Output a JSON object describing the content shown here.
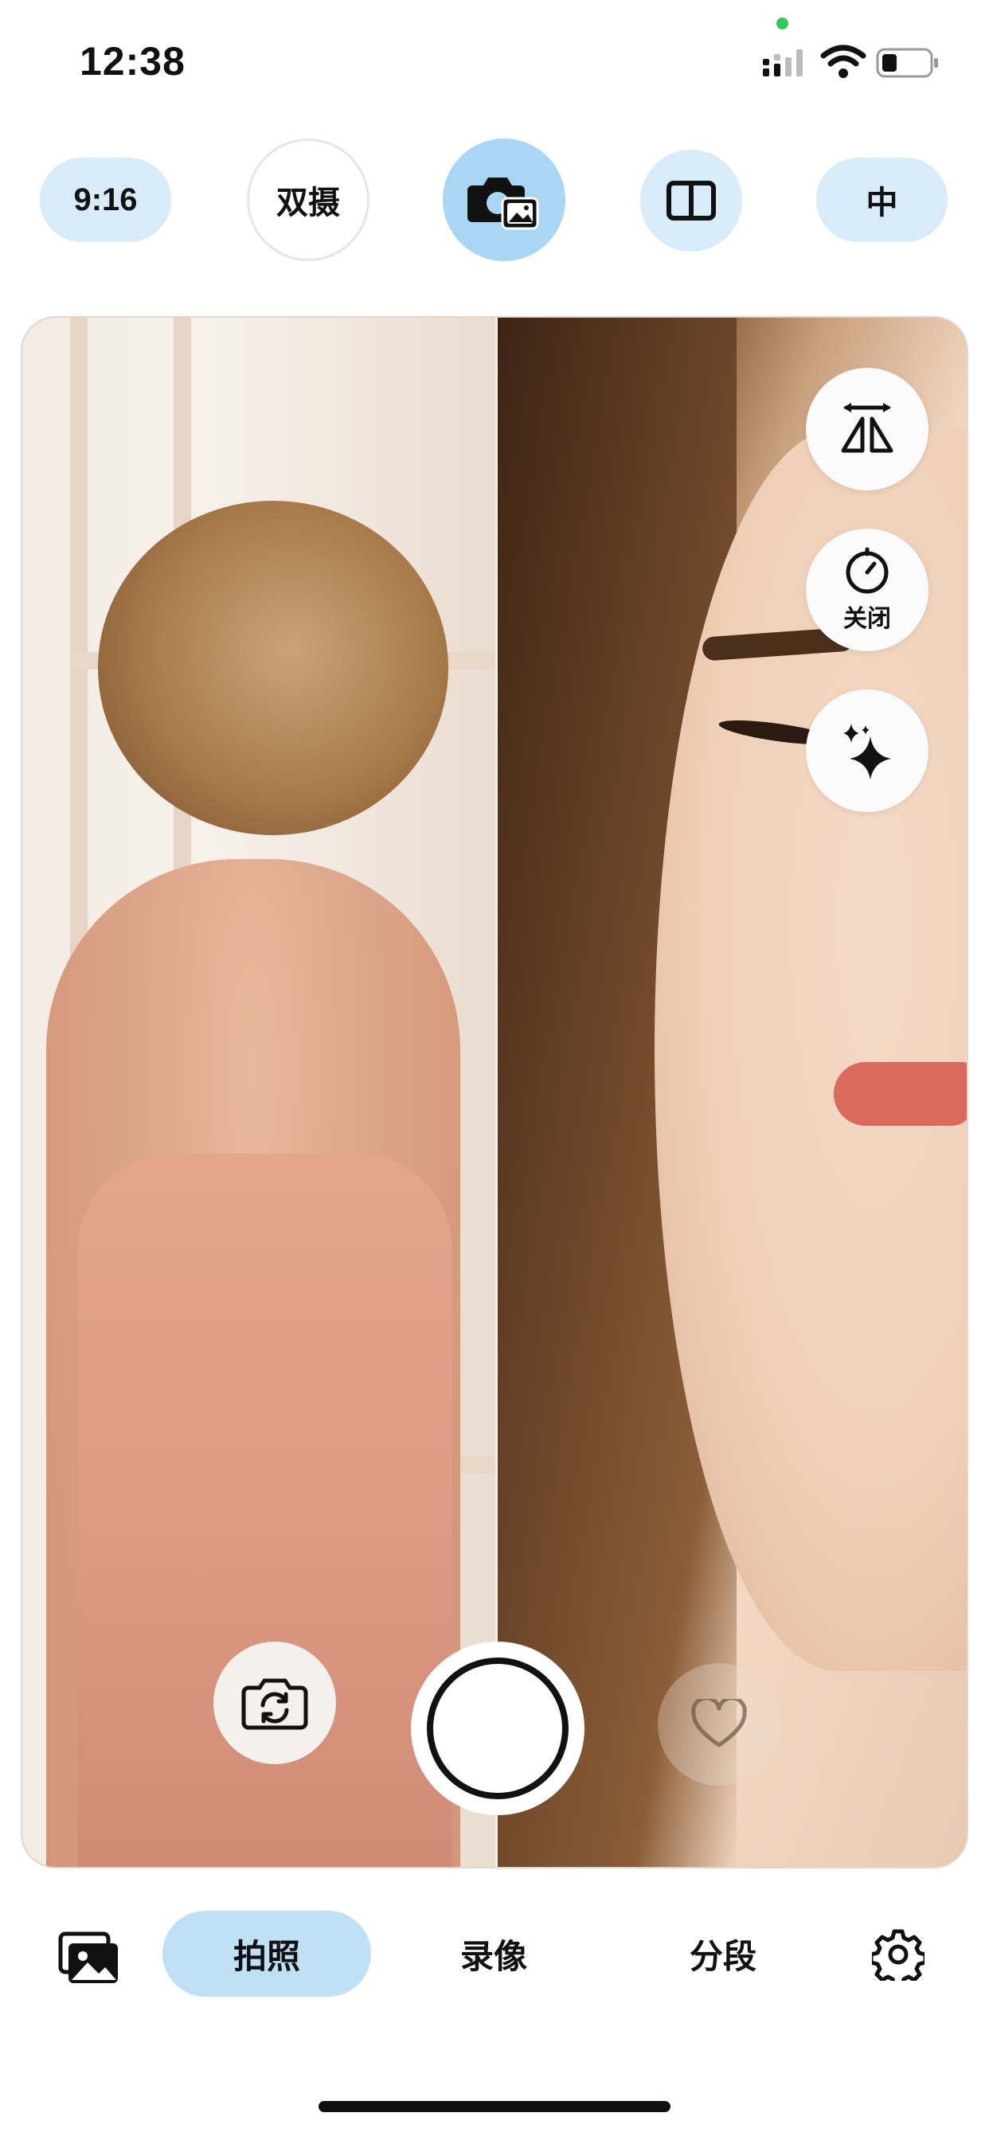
{
  "status_bar": {
    "time": "12:38"
  },
  "toolbar": {
    "aspect_ratio": "9:16",
    "dual_camera_label": "双摄",
    "quality_label": "中"
  },
  "viewfinder": {
    "timer_label": "关闭"
  },
  "modes": {
    "photo": "拍照",
    "video": "录像",
    "segment": "分段",
    "active": "拍照"
  },
  "icons": {
    "signal": "signal-icon",
    "wifi": "wifi-icon",
    "battery": "battery-icon",
    "photo_mode": "camera-photo-icon",
    "split": "split-screen-icon",
    "mirror": "mirror-flip-icon",
    "timer": "timer-icon",
    "beauty": "sparkle-icon",
    "flip_camera": "flip-camera-icon",
    "favorite": "heart-icon",
    "gallery": "gallery-icon",
    "settings": "gear-icon"
  },
  "colors": {
    "accent": "#bfe0f5",
    "pill": "#d7ebf8",
    "active_circle": "#a8d6f3"
  }
}
